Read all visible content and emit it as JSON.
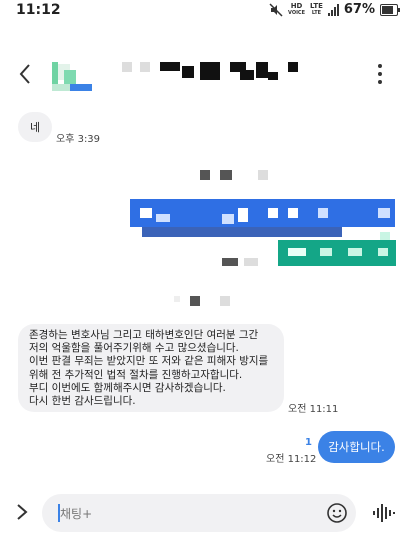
{
  "status": {
    "time": "11:12",
    "hd": "HD",
    "voice": "VOICE",
    "lte": "LTE",
    "lte_sub": "LTE",
    "battery": "67%"
  },
  "header": {
    "avatar_icon": "contact-avatar"
  },
  "messages": {
    "first": {
      "text": "네",
      "time": "오후 3:39"
    },
    "long": {
      "text": "존경하는 변호사님 그리고 태하변호인단 여러분 그간\n저의 억울함을 풀어주기위해 수고 많으셨습니다.\n이번 판결 무죄는 받았지만 또 저와 같은 피해자 방지를\n위해 전 추가적인 법적 절차를 진행하고자합니다.\n부디 이번에도 함께해주시면 감사하겠습니다.\n다시 한번 감사드립니다.",
      "time": "오전 11:11"
    },
    "sent": {
      "text": "감사합니다.",
      "unread": "1",
      "time": "오전 11:12"
    }
  },
  "composer": {
    "placeholder": "채팅+"
  },
  "colors": {
    "accent": "#3b82e6",
    "bubble_in": "#f1f1f3",
    "teal": "#14a687"
  }
}
